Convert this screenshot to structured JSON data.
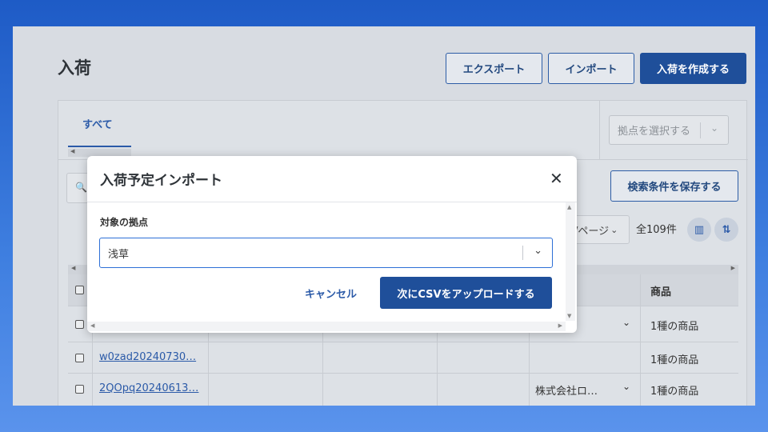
{
  "page": {
    "title": "入荷",
    "buttons": {
      "export": "エクスポート",
      "import": "インポート",
      "create": "入荷を作成する"
    }
  },
  "tabs": [
    {
      "label": "すべて",
      "active": true
    }
  ],
  "filters": {
    "location_placeholder": "拠点を選択する",
    "save_search": "検索条件を保存する",
    "per_page": "/ページ",
    "total": "全109件"
  },
  "table": {
    "product_header": "商品",
    "rows": [
      {
        "id": "",
        "supplier": "",
        "product": "1種の商品"
      },
      {
        "id": "w0zad20240730…",
        "supplier": "",
        "product": "1種の商品"
      },
      {
        "id": "2QOpq20240613…",
        "supplier": "株式会社ロ…",
        "product": "1種の商品"
      }
    ]
  },
  "modal": {
    "title": "入荷予定インポート",
    "field_label": "対象の拠点",
    "selected_location": "浅草",
    "cancel": "キャンセル",
    "next": "次にCSVをアップロードする"
  },
  "icons": {
    "close": "close-icon",
    "chevron": "chevron-down-icon",
    "search": "search-icon",
    "columns": "columns-icon",
    "sort": "sort-icon"
  },
  "colors": {
    "primary": "#1f4f9a",
    "accent": "#2d6fd6",
    "link": "#2b5aa8"
  }
}
